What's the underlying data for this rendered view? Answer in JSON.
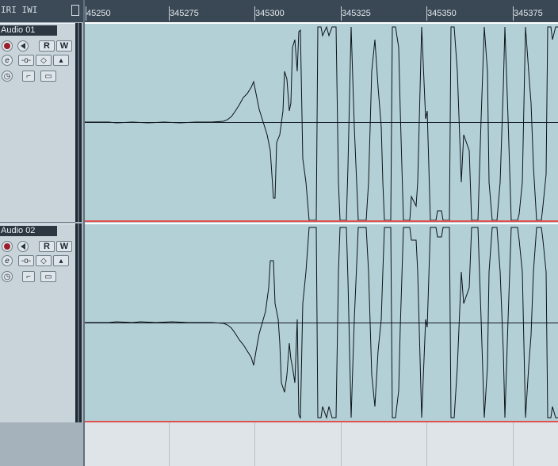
{
  "toolbar": {
    "rw_indicator": "IRI IWI"
  },
  "ruler": {
    "ticks": [
      "45250",
      "345275",
      "345300",
      "345325",
      "345350",
      "345375"
    ]
  },
  "tracks": [
    {
      "name": "Audio 01",
      "buttons": {
        "record_icon": "record-icon",
        "monitor_icon": "speaker-icon",
        "read": "R",
        "write": "W",
        "edit": "e",
        "eq": "eq-icon",
        "inserts": "inserts-icon",
        "sends": "sends-icon",
        "time": "clock-icon",
        "lock": "lock-icon",
        "lanes": "lanes-icon"
      }
    },
    {
      "name": "Audio 02",
      "buttons": {
        "record_icon": "record-icon",
        "monitor_icon": "speaker-icon",
        "read": "R",
        "write": "W",
        "edit": "e",
        "eq": "eq-icon",
        "inserts": "inserts-icon",
        "sends": "sends-icon",
        "time": "clock-icon",
        "lock": "lock-icon",
        "lanes": "lanes-icon"
      }
    }
  ],
  "colors": {
    "waveform_bg": "#b3d0d6",
    "ruler_bg": "#3a4855",
    "end_line": "#e0524f"
  }
}
